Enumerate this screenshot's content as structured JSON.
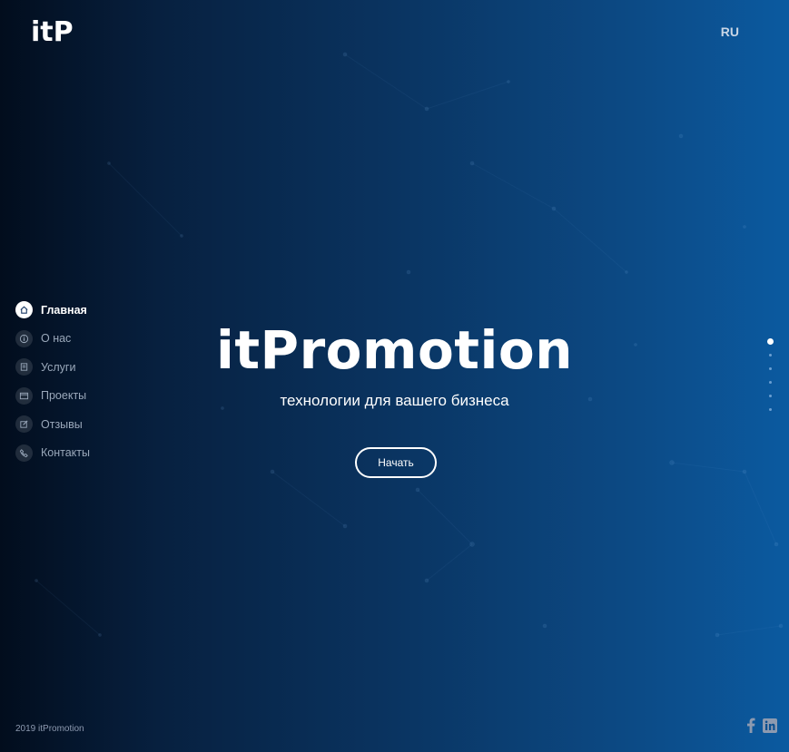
{
  "header": {
    "logo": "itP",
    "language": "RU"
  },
  "nav": {
    "items": [
      {
        "label": "Главная",
        "icon": "home-icon",
        "active": true
      },
      {
        "label": "О нас",
        "icon": "info-icon",
        "active": false
      },
      {
        "label": "Услуги",
        "icon": "list-icon",
        "active": false
      },
      {
        "label": "Проекты",
        "icon": "window-icon",
        "active": false
      },
      {
        "label": "Отзывы",
        "icon": "edit-icon",
        "active": false
      },
      {
        "label": "Контакты",
        "icon": "phone-icon",
        "active": false
      }
    ]
  },
  "hero": {
    "title": "itPromotion",
    "subtitle": "технологии для вашего бизнеса",
    "button": "Начать"
  },
  "pagination": {
    "total": 6,
    "active": 1
  },
  "footer": {
    "copyright": "2019 itPromotion",
    "social": [
      "facebook-icon",
      "linkedin-icon"
    ]
  },
  "colors": {
    "bg_left": "#020d1d",
    "bg_right": "#0b5aa0",
    "nav_inactive": "#9aa8ba",
    "dot": "#6b9fd2"
  }
}
